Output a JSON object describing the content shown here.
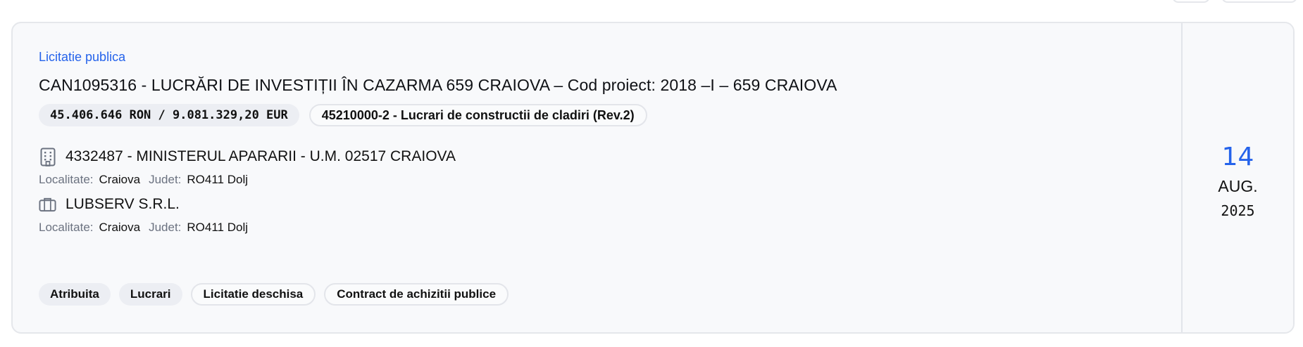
{
  "procedure": {
    "type_label": "Licitatie publica"
  },
  "title": "CAN1095316 - LUCRĂRI DE INVESTIȚII ÎN CAZARMA 659 CRAIOVA – Cod proiect: 2018 –I – 659 CRAIOVA",
  "value": {
    "label": "45.406.646 RON / 9.081.329,20 EUR"
  },
  "cpv": {
    "label": "45210000-2 - Lucrari de constructii de cladiri (Rev.2)"
  },
  "authority": {
    "name": "4332487 - MINISTERUL APARARII - U.M. 02517 CRAIOVA",
    "icon": "building-icon",
    "locality_key": "Localitate:",
    "locality_value": "Craiova",
    "county_key": "Judet:",
    "county_value": "RO411 Dolj"
  },
  "supplier": {
    "name": "LUBSERV S.R.L.",
    "icon": "briefcase-icon",
    "locality_key": "Localitate:",
    "locality_value": "Craiova",
    "county_key": "Judet:",
    "county_value": "RO411 Dolj"
  },
  "tags": [
    "Atribuita",
    "Lucrari",
    "Licitatie deschisa",
    "Contract de achizitii publice"
  ],
  "date": {
    "day": "14",
    "month": "AUG.",
    "year": "2025"
  },
  "colors": {
    "accent": "#2563eb",
    "card_bg": "#f8f9fb",
    "border": "#e5e7eb"
  }
}
